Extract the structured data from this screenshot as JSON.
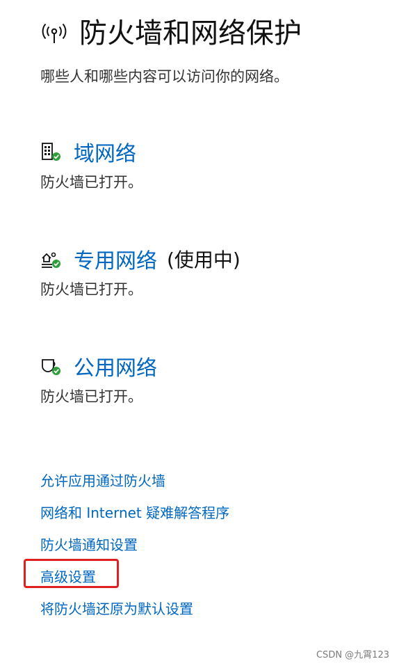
{
  "header": {
    "title": "防火墙和网络保护",
    "subtitle": "哪些人和哪些内容可以访问你的网络。",
    "icon": "antenna-broadcast-icon"
  },
  "networks": [
    {
      "name": "域网络",
      "suffix": "",
      "status": "防火墙已打开。",
      "icon": "building-shield-icon"
    },
    {
      "name": "专用网络",
      "suffix": "(使用中)",
      "status": "防火墙已打开。",
      "icon": "home-network-icon"
    },
    {
      "name": "公用网络",
      "suffix": "",
      "status": "防火墙已打开。",
      "icon": "coffee-cup-icon"
    }
  ],
  "links": [
    "允许应用通过防火墙",
    "网络和 Internet 疑难解答程序",
    "防火墙通知设置",
    "高级设置",
    "将防火墙还原为默认设置"
  ],
  "watermark": "CSDN @九霄123",
  "colors": {
    "link": "#0067c0",
    "status_ok": "#2e9d3a",
    "highlight": "#e02020"
  }
}
